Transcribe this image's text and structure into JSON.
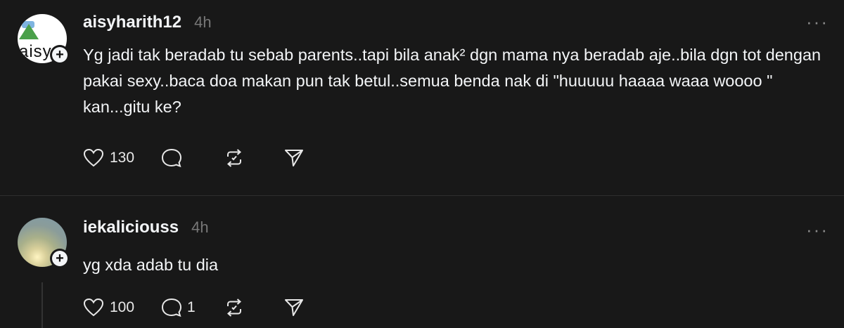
{
  "posts": [
    {
      "username": "aisyharith12",
      "time": "4h",
      "avatar_text": "aisy",
      "text": "Yg jadi tak beradab tu sebab parents..tapi bila anak² dgn mama nya beradab aje..bila dgn tot dengan pakai sexy..baca doa makan pun tak betul..semua benda nak di \"huuuuu haaaa waaa woooo \" kan...gitu ke?",
      "likes": "130",
      "comments": "",
      "more": "···"
    },
    {
      "username": "iekaliciouss",
      "time": "4h",
      "text": "yg xda adab tu dia",
      "likes": "100",
      "comments": "1",
      "more": "···"
    }
  ],
  "icons": {
    "add": "+",
    "like": "heart-icon",
    "comment": "comment-bubble-icon",
    "repost": "repost-icon",
    "share": "paper-plane-icon",
    "more": "more-options-icon"
  },
  "colors": {
    "background": "#181818",
    "text": "#f3f5f7",
    "muted": "#777777",
    "divider": "#2e2e2e"
  }
}
